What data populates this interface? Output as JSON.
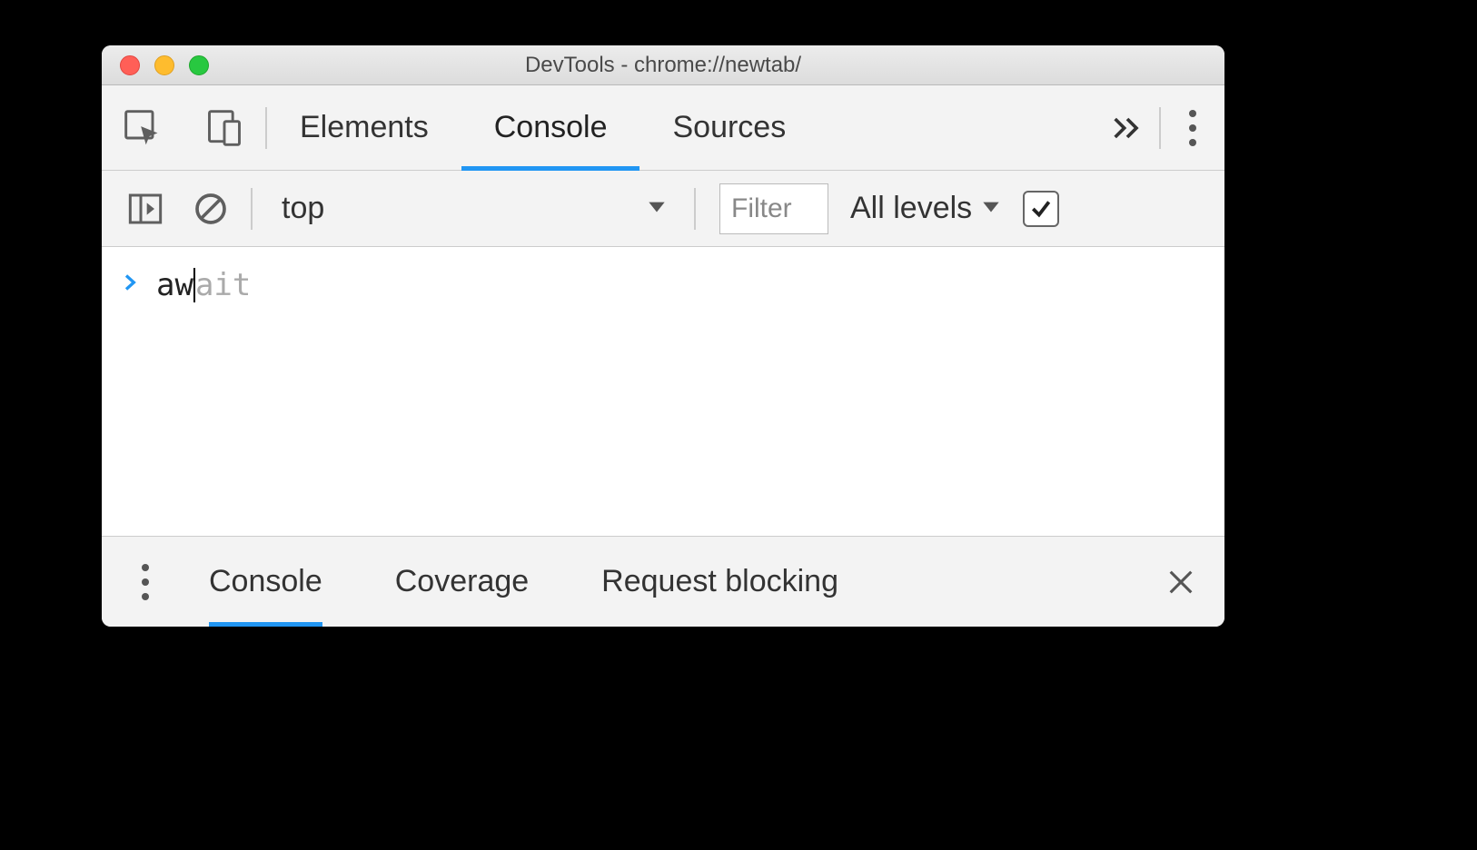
{
  "window": {
    "title": "DevTools - chrome://newtab/"
  },
  "topTabs": {
    "items": [
      "Elements",
      "Console",
      "Sources"
    ],
    "activeIndex": 1
  },
  "consoleToolbar": {
    "context": "top",
    "filterPlaceholder": "Filter",
    "levelsLabel": "All levels",
    "groupSimilarChecked": true
  },
  "consoleInput": {
    "typed": "aw",
    "suggestion": "ait"
  },
  "drawer": {
    "items": [
      "Console",
      "Coverage",
      "Request blocking"
    ],
    "activeIndex": 0
  }
}
